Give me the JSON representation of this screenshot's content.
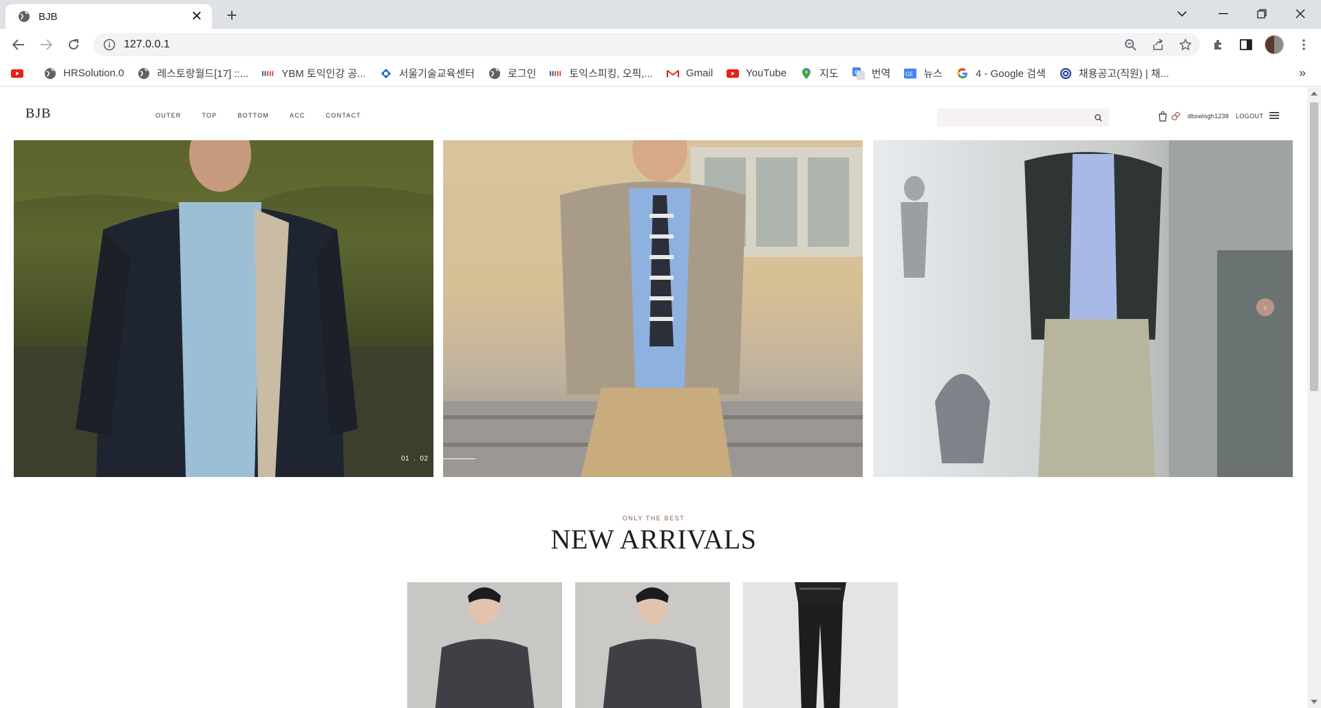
{
  "browser": {
    "tab_title": "BJB",
    "new_tab": "+",
    "url": "127.0.0.1"
  },
  "bookmarks": [
    {
      "label": "",
      "icon": "youtube-icon"
    },
    {
      "label": "HRSolution.0",
      "icon": "globe-icon"
    },
    {
      "label": "레스토랑월드[17] ::...",
      "icon": "globe-icon"
    },
    {
      "label": "YBM 토익인강 공...",
      "icon": "ybm-icon"
    },
    {
      "label": "서울기술교육센터",
      "icon": "puzzle-logo-icon"
    },
    {
      "label": "로그인",
      "icon": "globe-icon"
    },
    {
      "label": "토익스피킹, 오픽,...",
      "icon": "ybm-icon"
    },
    {
      "label": "Gmail",
      "icon": "gmail-icon"
    },
    {
      "label": "YouTube",
      "icon": "youtube-icon"
    },
    {
      "label": "지도",
      "icon": "maps-icon"
    },
    {
      "label": "번역",
      "icon": "translate-icon"
    },
    {
      "label": "뉴스",
      "icon": "news-icon"
    },
    {
      "label": "4 - Google 검색",
      "icon": "google-icon"
    },
    {
      "label": "채용공고(직원) | 채...",
      "icon": "emblem-icon"
    }
  ],
  "bookmarks_more": "»",
  "site": {
    "logo": "BJB",
    "nav": [
      "OUTER",
      "TOP",
      "BOTTOM",
      "ACC",
      "CONTACT"
    ],
    "search_placeholder": "",
    "username": "dbswlsgh1238",
    "logout": "LOGOUT"
  },
  "hero": {
    "pager_current": "01",
    "pager_next": "02",
    "next_arrow": "›",
    "slide_count_visible": 3
  },
  "section": {
    "kicker": "ONLY THE BEST",
    "title": "NEW ARRIVALS"
  },
  "colors": {
    "accent": "#c59d8c",
    "kicker": "#8b5d4d",
    "search_bg": "#f6f2f1"
  }
}
